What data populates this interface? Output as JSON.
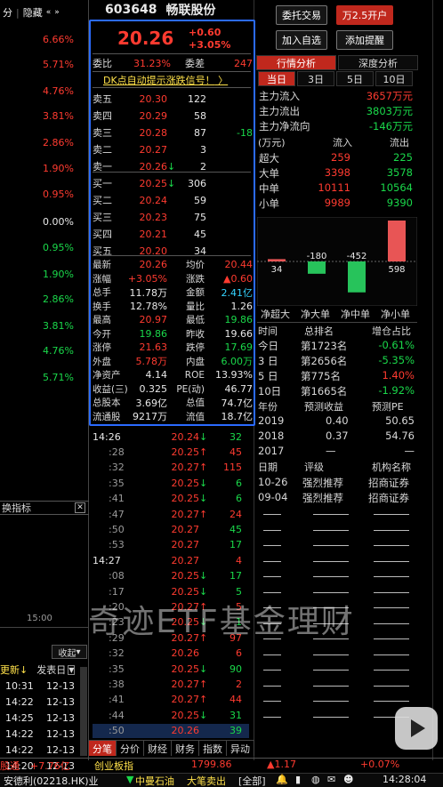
{
  "left": {
    "top_items": [
      "分",
      "隐藏"
    ],
    "pcts": [
      {
        "t": "6.66%",
        "c": "r"
      },
      {
        "t": "5.71%",
        "c": "r"
      },
      {
        "t": "4.76%",
        "c": "r"
      },
      {
        "t": "3.81%",
        "c": "r"
      },
      {
        "t": "2.86%",
        "c": "r"
      },
      {
        "t": "1.90%",
        "c": "r"
      },
      {
        "t": "0.95%",
        "c": "r"
      },
      {
        "t": "0.00%",
        "c": "w"
      },
      {
        "t": "0.95%",
        "c": "g"
      },
      {
        "t": "1.90%",
        "c": "g"
      },
      {
        "t": "2.86%",
        "c": "g"
      },
      {
        "t": "3.81%",
        "c": "g"
      },
      {
        "t": "4.76%",
        "c": "g"
      },
      {
        "t": "5.71%",
        "c": "g"
      }
    ],
    "indicator_label": "换指标",
    "time_label": "15:00",
    "collapse": "收起",
    "update_header": "更新",
    "publish_header": "发表日",
    "news": [
      {
        "time": "10:31",
        "date": "12-13"
      },
      {
        "time": "14:22",
        "date": "12-13"
      },
      {
        "time": "14:25",
        "date": "12-13"
      },
      {
        "time": "14:22",
        "date": "12-13"
      },
      {
        "time": "14:22",
        "date": "12-13"
      },
      {
        "time": "14:20",
        "date": "12-13"
      }
    ],
    "bottom": "股通",
    "bottom_val": "+7.76亿"
  },
  "stock": {
    "code": "603648",
    "name": "畅联股份",
    "price": "20.26",
    "change": "+0.60",
    "change_pct": "+3.05%",
    "ratio_label": "委比",
    "ratio": "31.23%",
    "diff_label": "委差",
    "diff": "247",
    "signal": "DK点自动提示涨跌信号！",
    "sells": [
      {
        "l": "卖五",
        "p": "20.30",
        "v": "122",
        "x": ""
      },
      {
        "l": "卖四",
        "p": "20.29",
        "v": "58",
        "x": ""
      },
      {
        "l": "卖三",
        "p": "20.28",
        "v": "87",
        "x": "-18"
      },
      {
        "l": "卖二",
        "p": "20.27",
        "v": "3",
        "x": ""
      },
      {
        "l": "卖一",
        "p": "20.26",
        "v": "2",
        "x": ""
      }
    ],
    "buys": [
      {
        "l": "买一",
        "p": "20.25",
        "v": "306"
      },
      {
        "l": "买二",
        "p": "20.24",
        "v": "59"
      },
      {
        "l": "买三",
        "p": "20.23",
        "v": "75"
      },
      {
        "l": "买四",
        "p": "20.21",
        "v": "45"
      },
      {
        "l": "买五",
        "p": "20.20",
        "v": "34"
      }
    ],
    "stats": [
      {
        "a": "最新",
        "b": "20.26",
        "bc": "r",
        "c": "均价",
        "d": "20.44",
        "dc": "r"
      },
      {
        "a": "涨幅",
        "b": "+3.05%",
        "bc": "r",
        "c": "涨跌",
        "d": "▲0.60",
        "dc": "r"
      },
      {
        "a": "总手",
        "b": "11.78万",
        "bc": "w",
        "c": "金额",
        "d": "2.41亿",
        "dc": "c"
      },
      {
        "a": "换手",
        "b": "12.78%",
        "bc": "w",
        "c": "量比",
        "d": "1.26",
        "dc": "w"
      },
      {
        "a": "最高",
        "b": "20.97",
        "bc": "r",
        "c": "最低",
        "d": "19.86",
        "dc": "g"
      },
      {
        "a": "今开",
        "b": "19.86",
        "bc": "g",
        "c": "昨收",
        "d": "19.66",
        "dc": "w"
      },
      {
        "a": "涨停",
        "b": "21.63",
        "bc": "r",
        "c": "跌停",
        "d": "17.69",
        "dc": "g"
      },
      {
        "a": "外盘",
        "b": "5.78万",
        "bc": "r",
        "c": "内盘",
        "d": "6.00万",
        "dc": "g"
      },
      {
        "a": "净资产",
        "b": "4.14",
        "bc": "w",
        "c": "ROE",
        "d": "13.93%",
        "dc": "w"
      },
      {
        "a": "收益(三)",
        "b": "0.325",
        "bc": "w",
        "c": "PE(动)",
        "d": "46.77",
        "dc": "w"
      },
      {
        "a": "总股本",
        "b": "3.69亿",
        "bc": "w",
        "c": "总值",
        "d": "74.7亿",
        "dc": "w"
      },
      {
        "a": "流通股",
        "b": "9217万",
        "bc": "w",
        "c": "流值",
        "d": "18.7亿",
        "dc": "w"
      }
    ]
  },
  "ticks": [
    {
      "t": "14:26",
      "p": "20.24",
      "a": "↓",
      "ac": "g",
      "v": "32",
      "vc": "g"
    },
    {
      "t": ":28",
      "p": "20.25",
      "a": "↑",
      "ac": "r",
      "v": "45",
      "vc": "r"
    },
    {
      "t": ":32",
      "p": "20.27",
      "a": "↑",
      "ac": "r",
      "v": "115",
      "vc": "r"
    },
    {
      "t": ":35",
      "p": "20.25",
      "a": "↓",
      "ac": "g",
      "v": "6",
      "vc": "g"
    },
    {
      "t": ":41",
      "p": "20.25",
      "a": "↓",
      "ac": "g",
      "v": "6",
      "vc": "g"
    },
    {
      "t": ":47",
      "p": "20.27",
      "a": "↑",
      "ac": "r",
      "v": "24",
      "vc": "r"
    },
    {
      "t": ":50",
      "p": "20.27",
      "a": "",
      "ac": "",
      "v": "45",
      "vc": "g"
    },
    {
      "t": ":53",
      "p": "20.27",
      "a": "",
      "ac": "",
      "v": "17",
      "vc": "g"
    },
    {
      "t": "14:27",
      "p": "20.27",
      "a": "",
      "ac": "",
      "v": "4",
      "vc": "r"
    },
    {
      "t": ":08",
      "p": "20.25",
      "a": "↓",
      "ac": "g",
      "v": "17",
      "vc": "g"
    },
    {
      "t": ":17",
      "p": "20.25",
      "a": "↓",
      "ac": "g",
      "v": "5",
      "vc": "g"
    },
    {
      "t": ":20",
      "p": "20.27",
      "a": "↑",
      "ac": "r",
      "v": "5",
      "vc": "r"
    },
    {
      "t": ":23",
      "p": "20.25",
      "a": "↓",
      "ac": "g",
      "v": "1",
      "vc": "g"
    },
    {
      "t": ":29",
      "p": "20.27",
      "a": "↑",
      "ac": "r",
      "v": "97",
      "vc": "r"
    },
    {
      "t": ":32",
      "p": "20.26",
      "a": "",
      "ac": "",
      "v": "6",
      "vc": "r"
    },
    {
      "t": ":35",
      "p": "20.25",
      "a": "↓",
      "ac": "g",
      "v": "90",
      "vc": "g"
    },
    {
      "t": ":38",
      "p": "20.27",
      "a": "↑",
      "ac": "r",
      "v": "2",
      "vc": "r"
    },
    {
      "t": ":41",
      "p": "20.27",
      "a": "↑",
      "ac": "r",
      "v": "44",
      "vc": "r"
    },
    {
      "t": ":44",
      "p": "20.25",
      "a": "↓",
      "ac": "g",
      "v": "31",
      "vc": "g"
    },
    {
      "t": ":50",
      "p": "20.26",
      "a": "",
      "ac": "",
      "v": "39",
      "vc": "g"
    }
  ],
  "mid_tabs": [
    "分笔",
    "分价",
    "财经",
    "财务",
    "指数",
    "异动"
  ],
  "right": {
    "btn1": "委托交易",
    "btn2": "万2.5开户",
    "btn3": "加入自选",
    "btn4": "添加提醒",
    "tab_a": "行情分析",
    "tab_b": "深度分析",
    "day_tabs": [
      "当日",
      "3日",
      "5日",
      "10日"
    ],
    "flows": [
      {
        "l": "主力流入",
        "v": "3657万元",
        "c": "r"
      },
      {
        "l": "主力流出",
        "v": "3803万元",
        "c": "g"
      },
      {
        "l": "主力净流向",
        "v": "-146万元",
        "c": "g"
      }
    ],
    "unit": "(万元)",
    "in_h": "流入",
    "out_h": "流出",
    "tbl": [
      {
        "l": "超大",
        "a": "259",
        "b": "225"
      },
      {
        "l": "大单",
        "a": "3398",
        "b": "3578"
      },
      {
        "l": "中单",
        "a": "10111",
        "b": "10564"
      },
      {
        "l": "小单",
        "a": "9989",
        "b": "9390"
      }
    ],
    "bar_vals": [
      "34",
      "-180",
      "-452",
      "598"
    ],
    "bar_labels": [
      "净超大",
      "净大单",
      "净中单",
      "净小单"
    ],
    "rank_h": [
      "时间",
      "总排名",
      "增仓占比"
    ],
    "ranks": [
      {
        "a": "今日",
        "b": "第1723名",
        "c": "-0.61%",
        "cc": "g"
      },
      {
        "a": "3 日",
        "b": "第2656名",
        "c": "-5.35%",
        "cc": "g"
      },
      {
        "a": "5 日",
        "b": "第775名",
        "c": "1.40%",
        "cc": "r"
      },
      {
        "a": "10日",
        "b": "第1665名",
        "c": "-1.92%",
        "cc": "g"
      }
    ],
    "fc_h": [
      "年份",
      "预测收益",
      "预测PE"
    ],
    "fc": [
      {
        "a": "2019",
        "b": "0.40",
        "c": "50.65"
      },
      {
        "a": "2018",
        "b": "0.37",
        "c": "54.76"
      },
      {
        "a": "2017",
        "b": "—",
        "c": "—"
      }
    ],
    "rt_h": [
      "日期",
      "评级",
      "机构名称"
    ],
    "rt": [
      {
        "a": "10-26",
        "b": "强烈推荐",
        "c": "招商证券"
      },
      {
        "a": "09-04",
        "b": "强烈推荐",
        "c": "招商证券"
      }
    ]
  },
  "status": {
    "index_name": "创业板指",
    "index_val": "1799.86",
    "index_chg": "▲1.17",
    "index_pct": "+0.07%",
    "ticker1": "安德利(02218.HK)业",
    "ticker2": "中曼石油",
    "ticker3": "大笔卖出",
    "ticker4": "[全部]",
    "time": "14:28:04"
  },
  "watermark": "奇迹ETF基金理财"
}
